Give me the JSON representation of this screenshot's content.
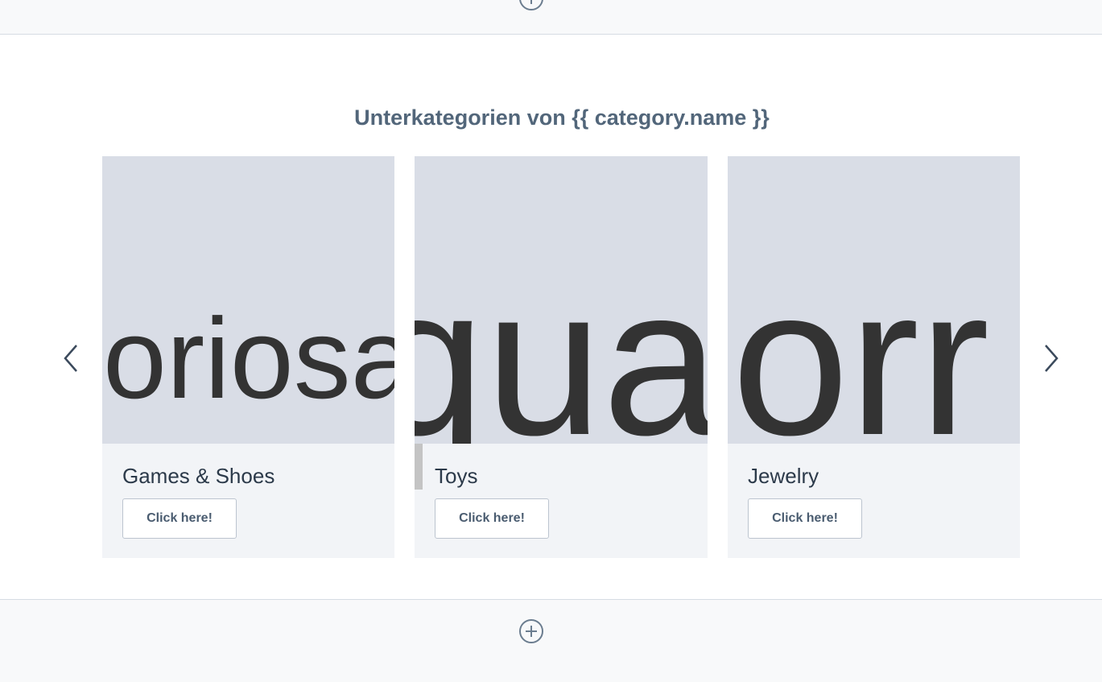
{
  "section": {
    "heading": "Unterkategorien von {{ category.name }}"
  },
  "carousel": {
    "prev_icon": "chevron-left-icon",
    "next_icon": "chevron-right-icon",
    "cards": [
      {
        "image_text": "poriosa",
        "title": "Games & Shoes",
        "button_label": "Click here!"
      },
      {
        "image_text": "qua",
        "title": "Toys",
        "button_label": "Click here!"
      },
      {
        "image_text": "orr",
        "title": "Jewelry",
        "button_label": "Click here!"
      }
    ]
  },
  "controls": {
    "add_block_icon": "plus-circle-icon"
  },
  "colors": {
    "heading": "#52667a",
    "card_background": "#f2f4f7",
    "image_placeholder": "#d9dde6",
    "band_background": "#f8f9fa"
  }
}
